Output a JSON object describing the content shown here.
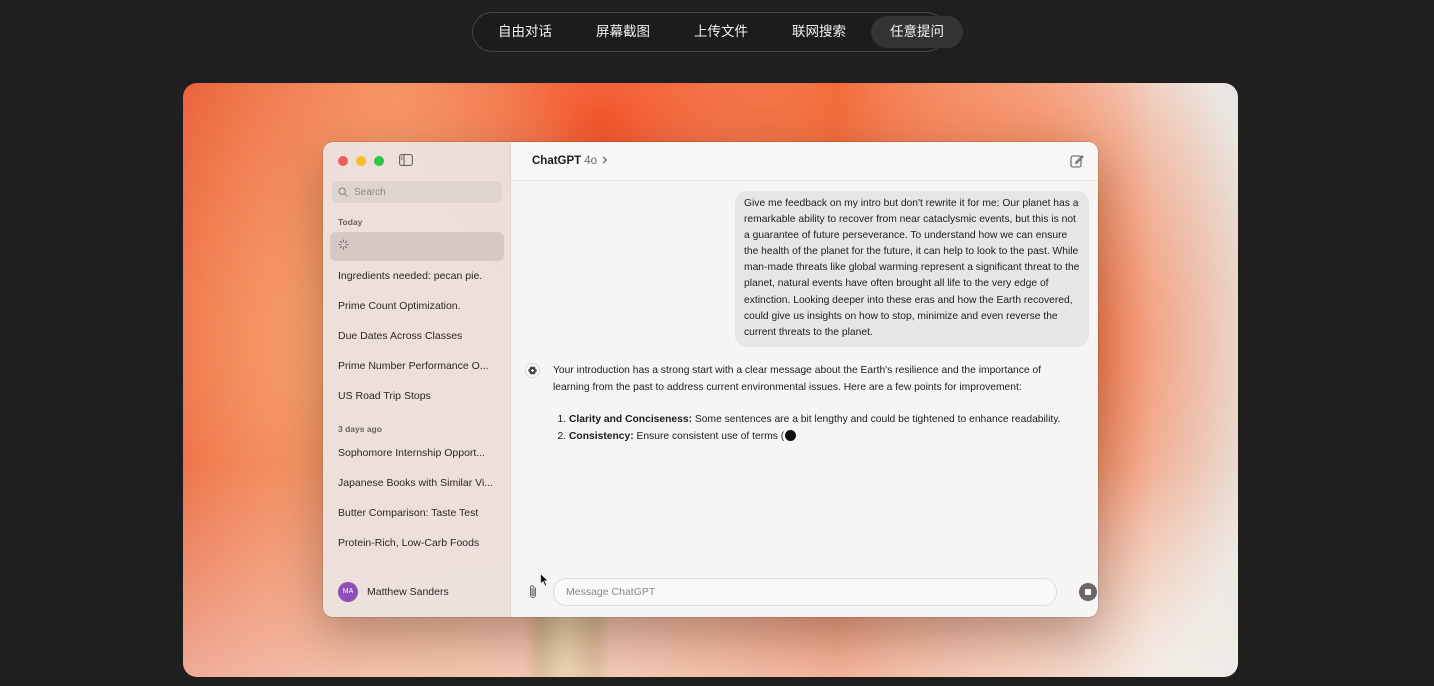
{
  "tabs": [
    {
      "label": "自由对话"
    },
    {
      "label": "屏幕截图"
    },
    {
      "label": "上传文件"
    },
    {
      "label": "联网搜索"
    },
    {
      "label": "任意提问"
    }
  ],
  "active_tab": "任意提问",
  "sidebar": {
    "search_placeholder": "Search",
    "sections": [
      {
        "label": "Today"
      },
      {
        "label": "3 days ago"
      }
    ],
    "items_today": [
      {
        "label": "Ingredients needed: pecan pie."
      },
      {
        "label": "Prime Count Optimization."
      },
      {
        "label": "Due Dates Across Classes"
      },
      {
        "label": "Prime Number Performance O..."
      },
      {
        "label": "US Road Trip Stops"
      }
    ],
    "items_earlier": [
      {
        "label": "Sophomore Internship Opport..."
      },
      {
        "label": "Japanese Books with Similar Vi..."
      },
      {
        "label": "Butter Comparison: Taste Test"
      },
      {
        "label": "Protein-Rich, Low-Carb Foods"
      }
    ],
    "user": {
      "initials": "MA",
      "name": "Matthew Sanders"
    }
  },
  "header": {
    "model": "ChatGPT",
    "version": "4o"
  },
  "conversation": {
    "user_message": "Give me feedback on my intro but don't rewrite it for me: Our planet has a remarkable ability to recover from near cataclysmic events, but this is not a guarantee of future perseverance. To understand how we can ensure the health of the planet for the future, it can help to look to the past. While man-made threats like global warming represent a significant threat to the planet, natural events have often brought all life to the very edge of extinction. Looking deeper into these eras and how the Earth recovered, could give us insights on how to stop, minimize and even reverse the current threats to the planet.",
    "assistant_intro": "Your introduction has a strong start with a clear message about the Earth's resilience and the importance of learning from the past to address current environmental issues. Here are a few points for improvement:",
    "points": [
      {
        "title": "Clarity and Conciseness:",
        "text": " Some sentences are a bit lengthy and could be tightened to enhance readability."
      },
      {
        "title": "Consistency:",
        "text": " Ensure consistent use of terms ("
      }
    ]
  },
  "composer": {
    "placeholder": "Message ChatGPT"
  }
}
